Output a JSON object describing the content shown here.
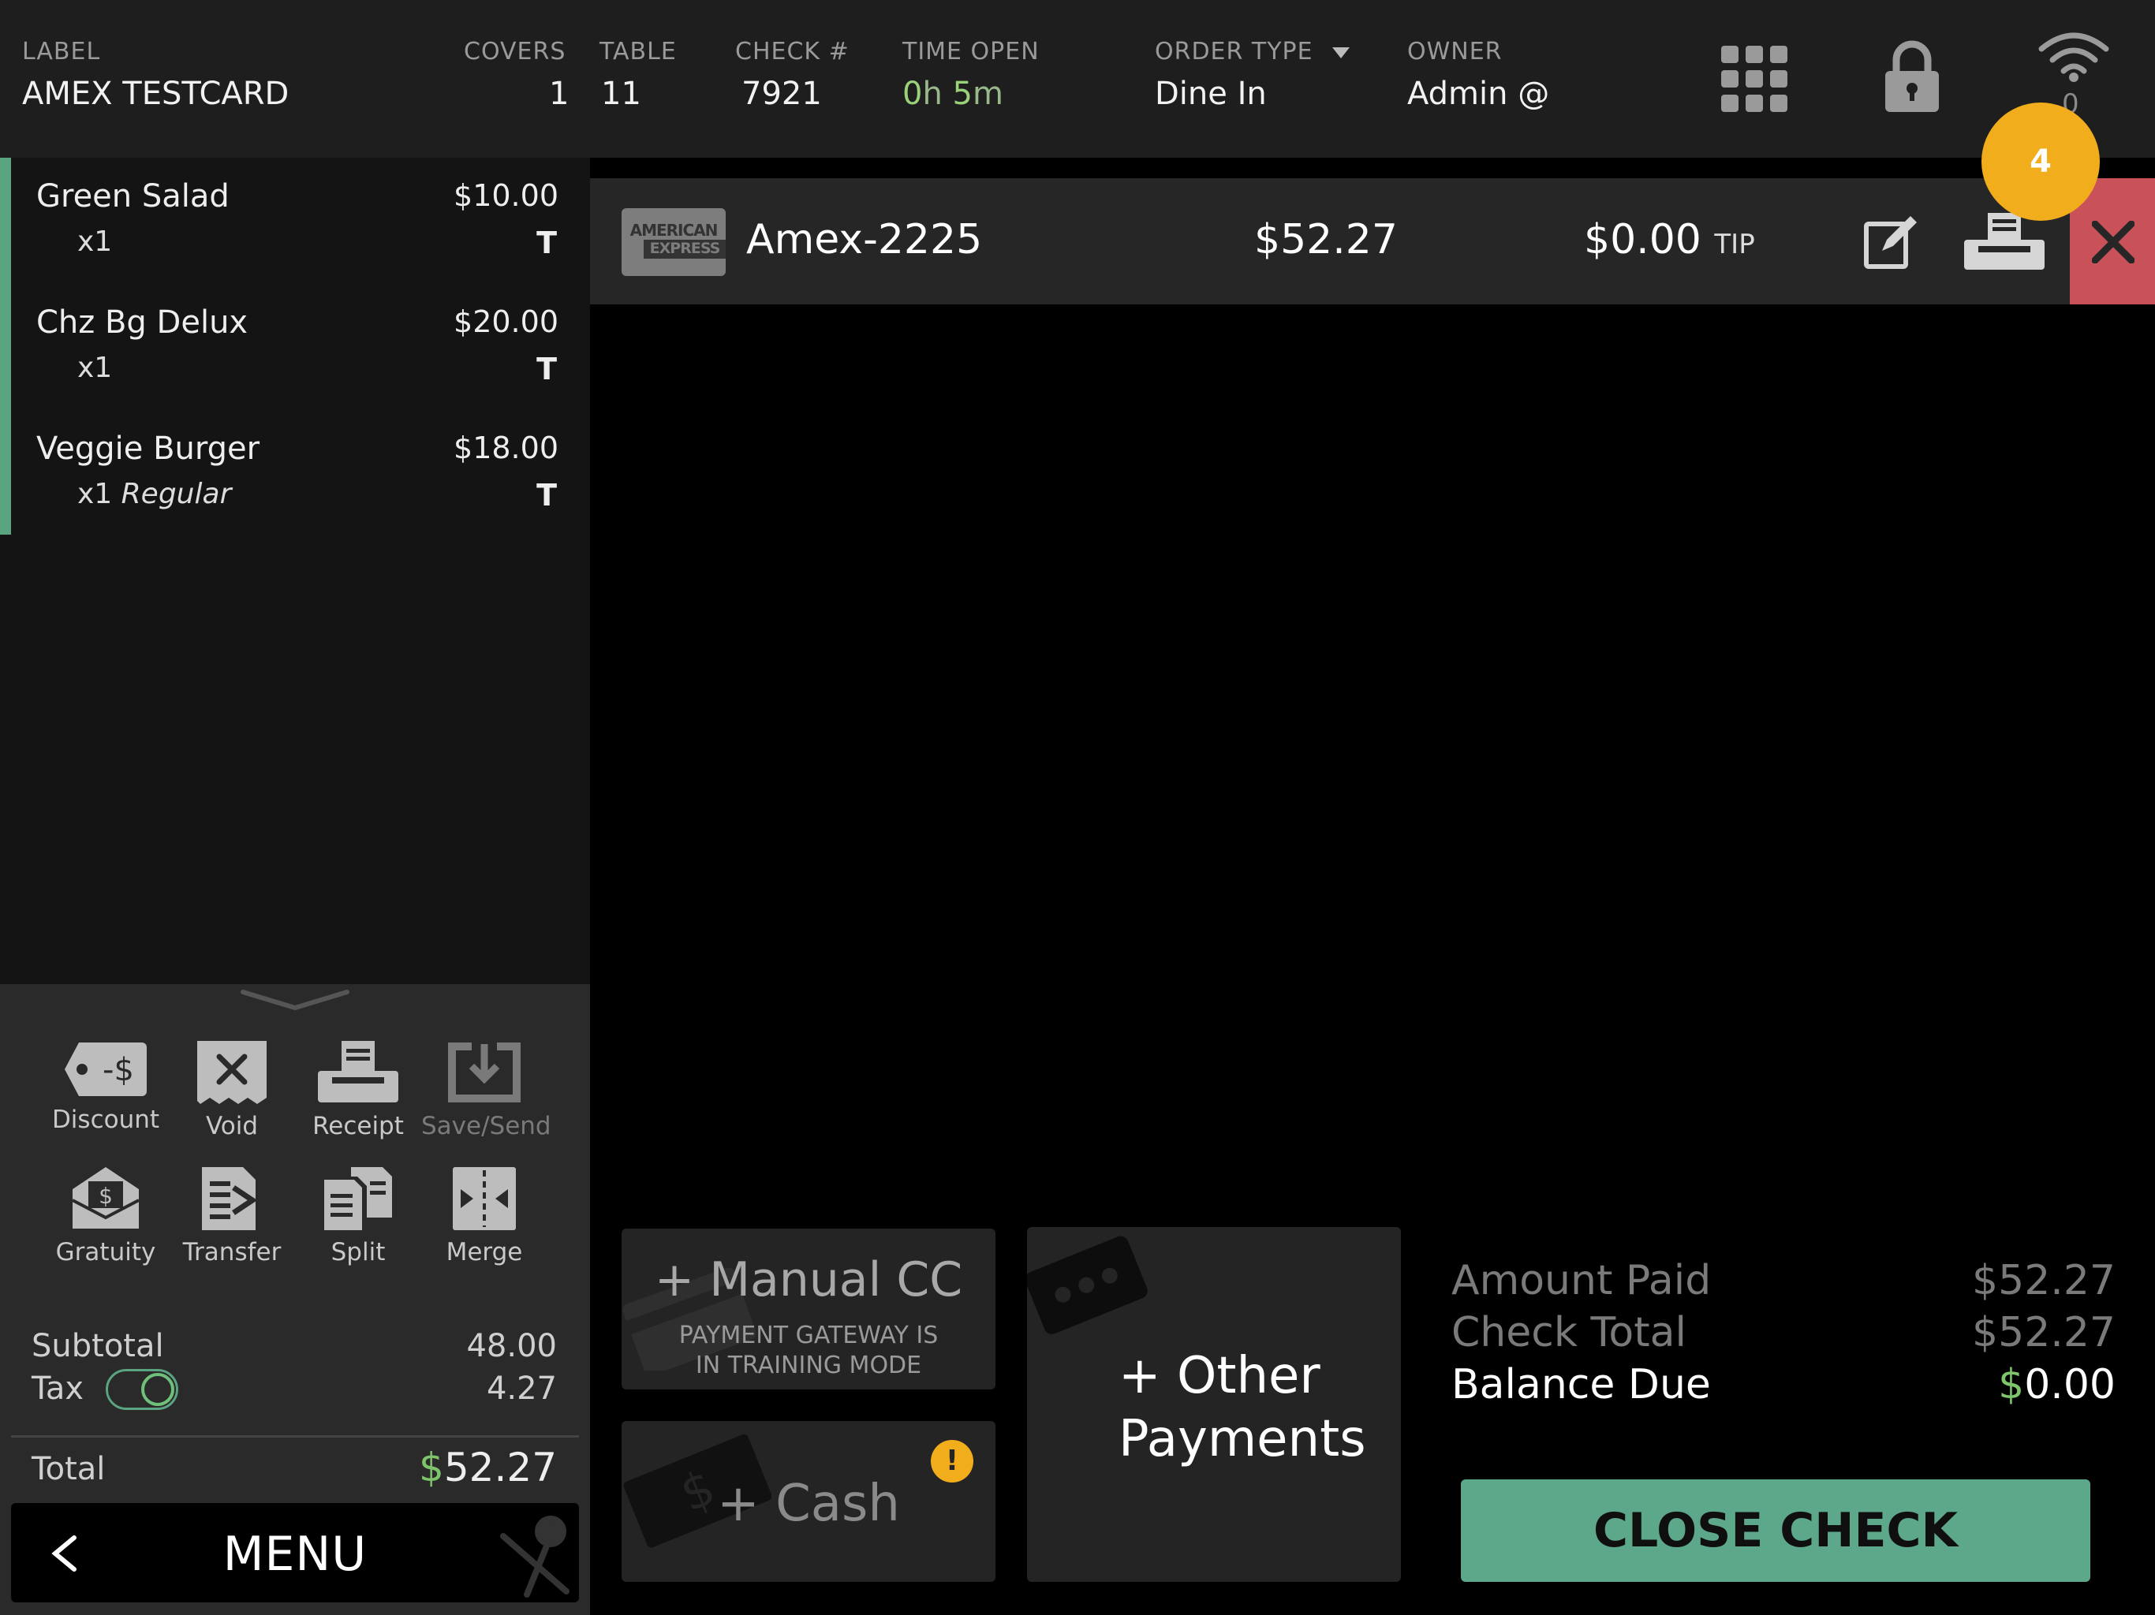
{
  "header": {
    "label_title": "LABEL",
    "label_value": "AMEX TESTCARD",
    "covers_title": "COVERS",
    "covers_value": "1",
    "table_title": "TABLE",
    "table_value": "11",
    "check_title": "CHECK #",
    "check_value": "7921",
    "time_title": "TIME OPEN",
    "time_h": "0",
    "time_h_unit": "h",
    "time_m": "5",
    "time_m_unit": "m",
    "order_type_title": "ORDER TYPE",
    "order_type_value": "Dine In",
    "owner_title": "OWNER",
    "owner_value": "Admin @",
    "wifi_count": "0",
    "badge_count": "4"
  },
  "items": [
    {
      "name": "Green Salad",
      "price": "$10.00",
      "qty": "x1",
      "modifier": "",
      "tax": "T"
    },
    {
      "name": "Chz Bg Delux",
      "price": "$20.00",
      "qty": "x1",
      "modifier": "",
      "tax": "T"
    },
    {
      "name": "Veggie Burger",
      "price": "$18.00",
      "qty": "x1",
      "modifier": "Regular",
      "tax": "T"
    }
  ],
  "actions": {
    "discount": "Discount",
    "void": "Void",
    "receipt": "Receipt",
    "save_send": "Save/Send",
    "gratuity": "Gratuity",
    "transfer": "Transfer",
    "split": "Split",
    "merge": "Merge"
  },
  "totals": {
    "subtotal_label": "Subtotal",
    "subtotal_value": "48.00",
    "tax_label": "Tax",
    "tax_value": "4.27",
    "total_label": "Total",
    "total_currency": "$",
    "total_value": "52.27"
  },
  "menu": {
    "label": "MENU"
  },
  "payment": {
    "card_logo_line1": "AMERICAN",
    "card_logo_line2": "EXPRESS",
    "card_name": "Amex-2225",
    "amount": "$52.27",
    "tip_amount": "$0.00",
    "tip_label": "TIP"
  },
  "tiles": {
    "manual_cc": "+ Manual CC",
    "manual_cc_note1": "PAYMENT GATEWAY IS",
    "manual_cc_note2": "IN TRAINING MODE",
    "cash": "+ Cash",
    "other1": "+ Other",
    "other2": "Payments"
  },
  "summary": {
    "amount_paid_label": "Amount Paid",
    "amount_paid_value": "$52.27",
    "check_total_label": "Check Total",
    "check_total_value": "$52.27",
    "balance_due_label": "Balance Due",
    "balance_currency": "$",
    "balance_due_value": "0.00"
  },
  "close_check": "CLOSE CHECK",
  "colors": {
    "accent_green": "#5da88a",
    "money_green": "#7ec46a",
    "danger_red": "#c9525a",
    "badge_yellow": "#f2ad1c"
  }
}
